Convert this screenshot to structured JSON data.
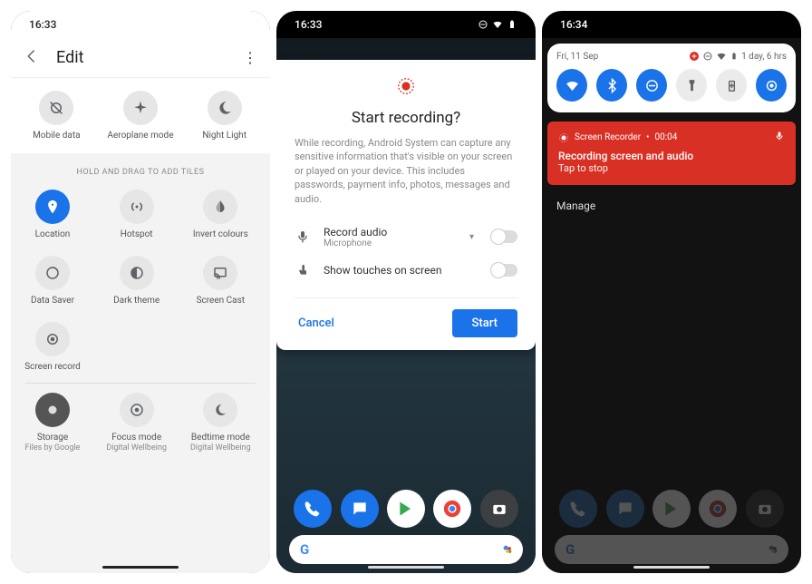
{
  "screen1": {
    "time": "16:33",
    "header": {
      "title": "Edit"
    },
    "top_tiles": [
      {
        "name": "mobile-data",
        "label": "Mobile data"
      },
      {
        "name": "aeroplane-mode",
        "label": "Aeroplane mode"
      },
      {
        "name": "night-light",
        "label": "Night Light"
      }
    ],
    "hint": "HOLD AND DRAG TO ADD TILES",
    "add_tiles": [
      {
        "name": "location",
        "label": "Location",
        "active": true
      },
      {
        "name": "hotspot",
        "label": "Hotspot"
      },
      {
        "name": "invert-colours",
        "label": "Invert colours"
      },
      {
        "name": "data-saver",
        "label": "Data Saver"
      },
      {
        "name": "dark-theme",
        "label": "Dark theme"
      },
      {
        "name": "screen-cast",
        "label": "Screen Cast"
      },
      {
        "name": "screen-record",
        "label": "Screen record"
      }
    ],
    "bottom_tiles": [
      {
        "name": "storage",
        "label": "Storage",
        "sub": "Files by Google"
      },
      {
        "name": "focus-mode",
        "label": "Focus mode",
        "sub": "Digital Wellbeing"
      },
      {
        "name": "bedtime-mode",
        "label": "Bedtime mode",
        "sub": "Digital Wellbeing"
      }
    ]
  },
  "screen2": {
    "time": "16:33",
    "dialog": {
      "title": "Start recording?",
      "desc": "While recording, Android System can capture any sensitive information that's visible on your screen or played on your device. This includes passwords, payment info, photos, messages and audio.",
      "opt1_title": "Record audio",
      "opt1_sub": "Microphone",
      "opt2_title": "Show touches on screen",
      "cancel": "Cancel",
      "start": "Start"
    }
  },
  "screen3": {
    "time": "16:34",
    "shade_date": "Fri, 11 Sep",
    "shade_battery": "1 day, 6 hrs",
    "qs": [
      {
        "name": "wifi",
        "on": true
      },
      {
        "name": "bluetooth",
        "on": true
      },
      {
        "name": "dnd",
        "on": true
      },
      {
        "name": "flashlight",
        "on": false
      },
      {
        "name": "battery-saver",
        "on": false
      },
      {
        "name": "screen-record",
        "on": true
      }
    ],
    "notif": {
      "app": "Screen Recorder",
      "time": "00:04",
      "title": "Recording screen and audio",
      "sub": "Tap to stop"
    },
    "manage": "Manage"
  },
  "colors": {
    "accent": "#1a73e8",
    "danger": "#d93025"
  }
}
